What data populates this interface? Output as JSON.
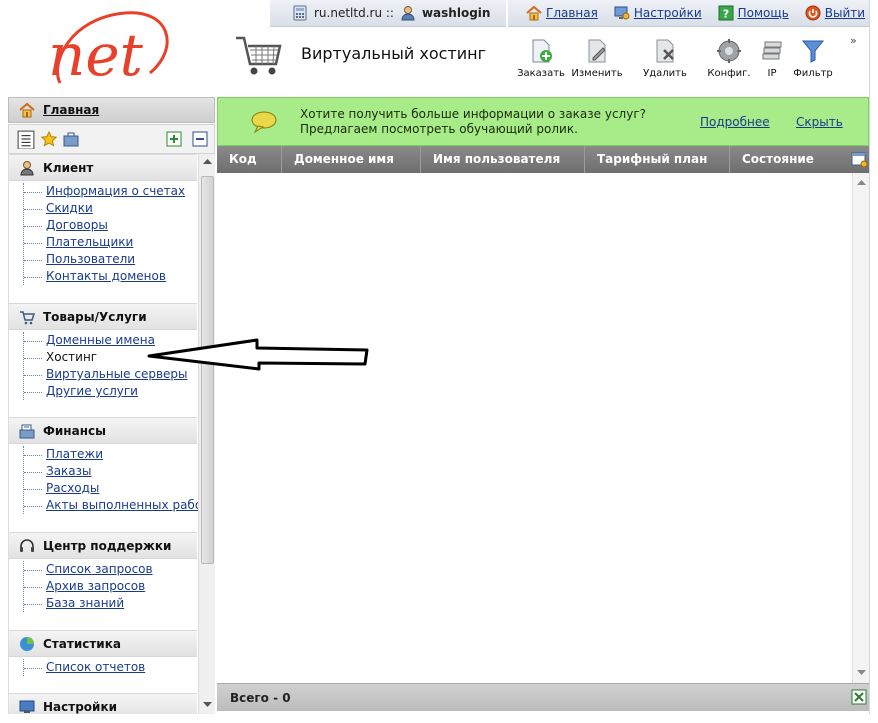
{
  "topbar": {
    "site": "ru.netltd.ru ::",
    "user": "washlogin",
    "links": [
      {
        "label": "Главная",
        "icon": "home-icon"
      },
      {
        "label": "Настройки",
        "icon": "settings-icon"
      },
      {
        "label": "Помощь",
        "icon": "help-icon"
      },
      {
        "label": "Выйти",
        "icon": "power-icon"
      }
    ]
  },
  "logo": {
    "text": "net"
  },
  "page": {
    "title": "Виртуальный хостинг"
  },
  "toolbar": [
    {
      "label": "Заказать",
      "icon": "add-document-icon"
    },
    {
      "label": "Изменить",
      "icon": "edit-document-icon"
    },
    {
      "label": "Удалить",
      "icon": "delete-document-icon"
    },
    {
      "label": "Конфиг.",
      "icon": "config-icon"
    },
    {
      "label": "IP",
      "icon": "ip-icon"
    },
    {
      "label": "Фильтр",
      "icon": "filter-icon"
    }
  ],
  "toolbar_more": "»",
  "sidebar": {
    "home_label": "Главная",
    "sections": [
      {
        "title": "Клиент",
        "icon": "client-icon",
        "items": [
          "Информация о счетах",
          "Скидки",
          "Договоры",
          "Плательщики",
          "Пользователи",
          "Контакты доменов"
        ],
        "active": -1
      },
      {
        "title": "Товары/Услуги",
        "icon": "cart-icon",
        "items": [
          "Доменные имена",
          "Хостинг",
          "Виртуальные серверы",
          "Другие услуги"
        ],
        "active": 1
      },
      {
        "title": "Финансы",
        "icon": "cash-register-icon",
        "items": [
          "Платежи",
          "Заказы",
          "Расходы",
          "Акты выполненных работ"
        ],
        "active": -1
      },
      {
        "title": "Центр поддержки",
        "icon": "headset-icon",
        "items": [
          "Список запросов",
          "Архив запросов",
          "База знаний"
        ],
        "active": -1
      },
      {
        "title": "Статистика",
        "icon": "chart-icon",
        "items": [
          "Список отчетов"
        ],
        "active": -1
      },
      {
        "title": "Настройки",
        "icon": "monitor-icon",
        "items": [],
        "active": -1
      }
    ]
  },
  "banner": {
    "line1": "Хотите получить больше информации о заказе услуг?",
    "line2": "Предлагаем посмотреть обучающий ролик.",
    "more_link": "Подробнее",
    "hide_link": "Скрыть"
  },
  "grid": {
    "columns": [
      "Код",
      "Доменное имя",
      "Имя пользователя",
      "Тарифный план",
      "Состояние"
    ],
    "total": "Всего - 0"
  },
  "colors": {
    "accent_red": "#e8402a",
    "banner_green": "#a7ec88",
    "link_blue": "#1a3b8c"
  }
}
